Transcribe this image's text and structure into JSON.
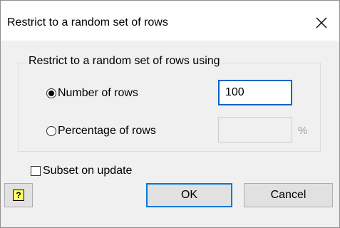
{
  "window": {
    "title": "Restrict to a random set of rows"
  },
  "group": {
    "legend": "Restrict to a random set of rows using",
    "options": [
      {
        "label": "Number of rows",
        "selected": true,
        "value": "100"
      },
      {
        "label": "Percentage of rows",
        "selected": false,
        "value": "",
        "unit": "%"
      }
    ]
  },
  "subset_on_update": {
    "label": "Subset on update",
    "checked": false
  },
  "buttons": {
    "help_glyph": "?",
    "ok": "OK",
    "cancel": "Cancel"
  },
  "colors": {
    "accent": "#0078d7",
    "help_icon_bg": "#ffff64"
  }
}
